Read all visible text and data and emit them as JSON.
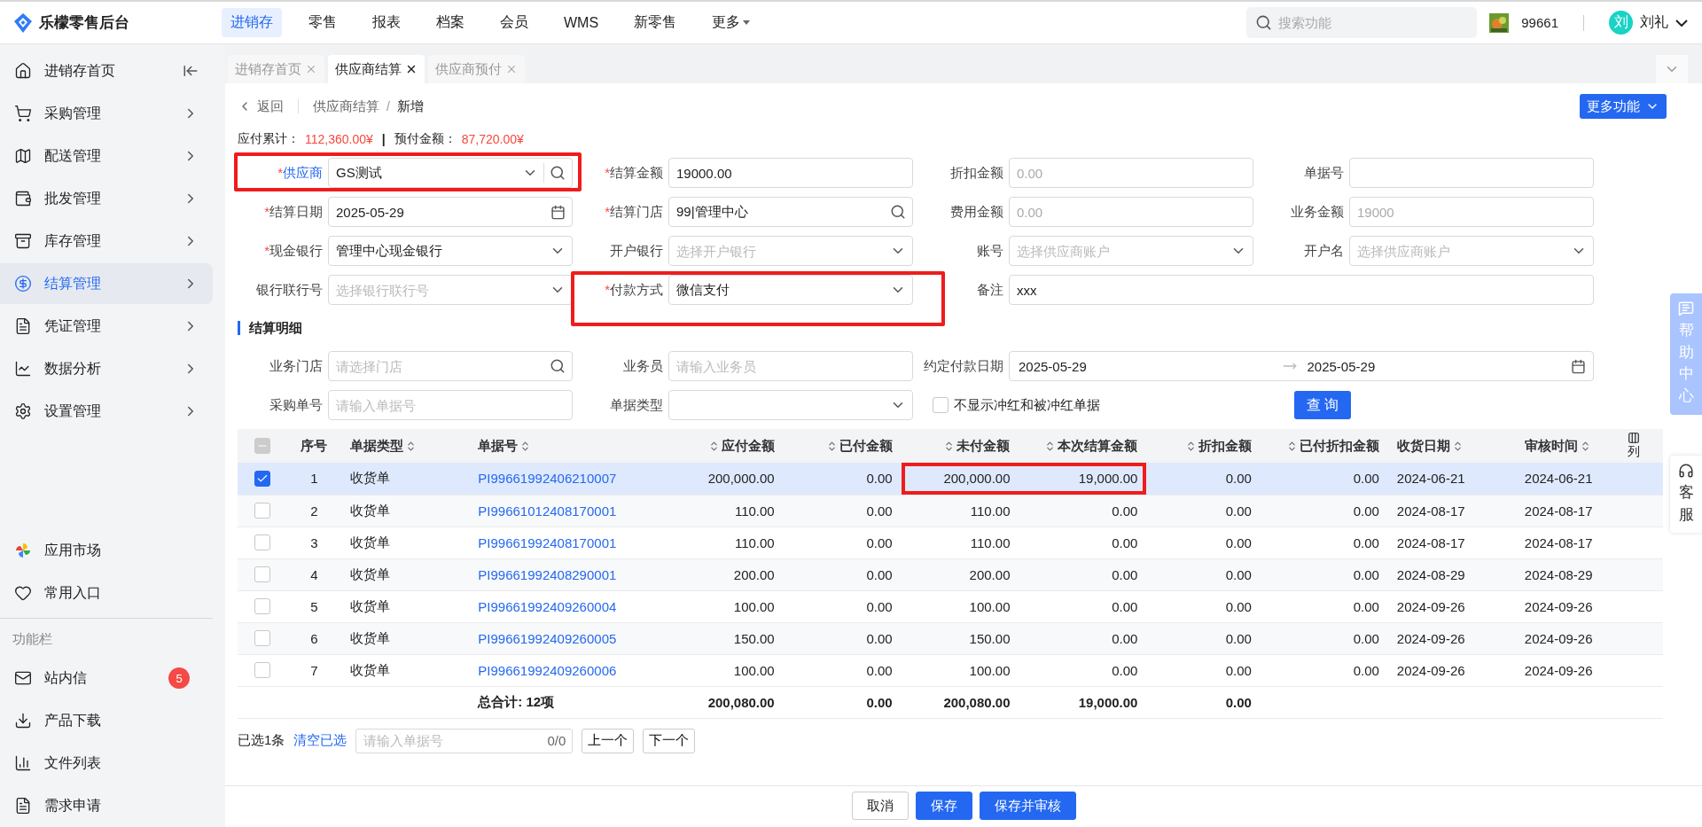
{
  "app": {
    "title": "乐檬零售后台"
  },
  "nav": [
    {
      "label": "进销存",
      "selected": true
    },
    {
      "label": "零售",
      "selected": false
    },
    {
      "label": "报表",
      "selected": false
    },
    {
      "label": "档案",
      "selected": false
    },
    {
      "label": "会员",
      "selected": false
    },
    {
      "label": "WMS",
      "selected": false
    },
    {
      "label": "新零售",
      "selected": false
    },
    {
      "label": "更多",
      "selected": false,
      "dropdown": true
    }
  ],
  "search": {
    "placeholder": "搜索功能"
  },
  "store": {
    "code": "99661"
  },
  "user": {
    "avatar": "刘",
    "name": "刘礼"
  },
  "sidebar": {
    "items": [
      {
        "label": "进销存首页",
        "selected": false
      },
      {
        "label": "采购管理",
        "selected": false
      },
      {
        "label": "配送管理",
        "selected": false
      },
      {
        "label": "批发管理",
        "selected": false
      },
      {
        "label": "库存管理",
        "selected": false
      },
      {
        "label": "结算管理",
        "selected": true
      },
      {
        "label": "凭证管理",
        "selected": false
      },
      {
        "label": "数据分析",
        "selected": false
      },
      {
        "label": "设置管理",
        "selected": false
      }
    ],
    "extras": [
      {
        "label": "应用市场"
      },
      {
        "label": "常用入口"
      }
    ],
    "section_title": "功能栏",
    "tools": [
      {
        "label": "站内信",
        "badge": "5"
      },
      {
        "label": "产品下载"
      },
      {
        "label": "文件列表"
      },
      {
        "label": "需求申请"
      }
    ]
  },
  "tabs": [
    {
      "label": "进销存首页",
      "selected": false
    },
    {
      "label": "供应商结算",
      "selected": true
    },
    {
      "label": "供应商预付",
      "selected": false
    }
  ],
  "breadcrumb": {
    "back": "返回",
    "path": "供应商结算",
    "separator": "/",
    "current": "新增"
  },
  "more_button": "更多功能",
  "summary": [
    {
      "label": "应付累计：",
      "value": "112,360.00¥"
    },
    {
      "label": "预付金额：",
      "value": "87,720.00¥"
    }
  ],
  "summary_separator": "|",
  "form": [
    {
      "label": "供应商",
      "required_mark": "*",
      "linked": true,
      "kind": "select-search",
      "value": "GS测试",
      "highlighted": true
    },
    {
      "label": "结算金额",
      "required_mark": "*",
      "kind": "text",
      "value": "19000.00"
    },
    {
      "label": "折扣金额",
      "kind": "text",
      "value": "0.00",
      "disabled": true
    },
    {
      "label": "单据号",
      "kind": "text"
    },
    {
      "label": "结算日期",
      "required_mark": "*",
      "kind": "date",
      "value": "2025-05-29"
    },
    {
      "label": "结算门店",
      "required_mark": "*",
      "kind": "search",
      "value": "99|管理中心"
    },
    {
      "label": "费用金额",
      "kind": "text",
      "value": "0.00",
      "disabled": true
    },
    {
      "label": "业务金额",
      "kind": "text",
      "value": "19000",
      "disabled": true
    },
    {
      "label": "现金银行",
      "required_mark": "*",
      "kind": "select",
      "value": "管理中心现金银行"
    },
    {
      "label": "开户银行",
      "kind": "select",
      "placeholder": "选择开户银行"
    },
    {
      "label": "账号",
      "kind": "select",
      "placeholder": "选择供应商账户"
    },
    {
      "label": "开户名",
      "kind": "select",
      "placeholder": "选择供应商账户"
    },
    {
      "label": "银行联行号",
      "kind": "select",
      "placeholder": "选择银行联行号"
    },
    {
      "label": "付款方式",
      "required_mark": "*",
      "kind": "select",
      "value": "微信支付",
      "highlighted": true
    },
    {
      "label": "备注",
      "kind": "text",
      "value": "xxx",
      "wide": true
    }
  ],
  "detail_title": "结算明细",
  "filters": [
    {
      "label": "业务门店",
      "kind": "search",
      "placeholder": "请选择门店"
    },
    {
      "label": "业务员",
      "kind": "text",
      "placeholder": "请输入业务员"
    },
    {
      "label": "约定付款日期",
      "kind": "range",
      "from": "2025-05-29",
      "to": "2025-05-29",
      "wide": true
    },
    {
      "label": "采购单号",
      "kind": "text",
      "placeholder": "请输入单据号"
    },
    {
      "label": "单据类型",
      "kind": "select"
    },
    {
      "label": "不显示冲红和被冲红单据",
      "kind": "checkbox",
      "checked": false
    },
    {
      "label": "查 询",
      "kind": "button"
    }
  ],
  "table": {
    "header_checkbox": {
      "indeterminate": true
    },
    "columns": [
      {
        "label": "序号",
        "kind": "index"
      },
      {
        "label": "单据类型",
        "kind": "text",
        "sortable": true
      },
      {
        "label": "单据号",
        "kind": "link",
        "sortable": true
      },
      {
        "label": "应付金额",
        "kind": "amount",
        "sortable": true
      },
      {
        "label": "已付金额",
        "kind": "amount",
        "sortable": true
      },
      {
        "label": "未付金额",
        "kind": "amount",
        "sortable": true,
        "highlighted": true
      },
      {
        "label": "本次结算金额",
        "kind": "amount",
        "sortable": true,
        "highlighted": true
      },
      {
        "label": "折扣金额",
        "kind": "amount",
        "sortable": true
      },
      {
        "label": "已付折扣金额",
        "kind": "amount",
        "sortable": true
      },
      {
        "label": "收货日期",
        "kind": "text",
        "sortable": true
      },
      {
        "label": "审核时间",
        "kind": "text",
        "sortable": true
      }
    ],
    "settings_label": "列",
    "rows": [
      {
        "checked": true,
        "highlighted": true,
        "cells": [
          "1",
          "收货单",
          "PI99661992406210007",
          "200,000.00",
          "0.00",
          "200,000.00",
          "19,000.00",
          "0.00",
          "0.00",
          "2024-06-21",
          "2024-06-21"
        ]
      },
      {
        "checked": false,
        "cells": [
          "2",
          "收货单",
          "PI99661012408170001",
          "110.00",
          "0.00",
          "110.00",
          "0.00",
          "0.00",
          "0.00",
          "2024-08-17",
          "2024-08-17"
        ]
      },
      {
        "checked": false,
        "cells": [
          "3",
          "收货单",
          "PI99661992408170001",
          "110.00",
          "0.00",
          "110.00",
          "0.00",
          "0.00",
          "0.00",
          "2024-08-17",
          "2024-08-17"
        ]
      },
      {
        "checked": false,
        "cells": [
          "4",
          "收货单",
          "PI99661992408290001",
          "200.00",
          "0.00",
          "200.00",
          "0.00",
          "0.00",
          "0.00",
          "2024-08-29",
          "2024-08-29"
        ]
      },
      {
        "checked": false,
        "cells": [
          "5",
          "收货单",
          "PI99661992409260004",
          "100.00",
          "0.00",
          "100.00",
          "0.00",
          "0.00",
          "0.00",
          "2024-09-26",
          "2024-09-26"
        ]
      },
      {
        "checked": false,
        "cells": [
          "6",
          "收货单",
          "PI99661992409260005",
          "150.00",
          "0.00",
          "150.00",
          "0.00",
          "0.00",
          "0.00",
          "2024-09-26",
          "2024-09-26"
        ]
      },
      {
        "checked": false,
        "cells": [
          "7",
          "收货单",
          "PI99661992409260006",
          "100.00",
          "0.00",
          "100.00",
          "0.00",
          "0.00",
          "0.00",
          "2024-09-26",
          "2024-09-26"
        ]
      }
    ],
    "totals": {
      "label": "总合计: 12项",
      "amounts": [
        "200,080.00",
        "0.00",
        "200,080.00",
        "19,000.00",
        "0.00"
      ]
    }
  },
  "pager": {
    "selected": "已选1条",
    "clear": "清空已选",
    "placeholder": "请输入单据号",
    "count": "0/0",
    "prev": "上一个",
    "next": "下一个"
  },
  "footer_buttons": [
    {
      "label": "取消",
      "primary": false
    },
    {
      "label": "保存",
      "primary": true
    },
    {
      "label": "保存并审核",
      "primary": true
    }
  ],
  "help": {
    "label": "帮助中心"
  },
  "service": {
    "label": "客服"
  }
}
